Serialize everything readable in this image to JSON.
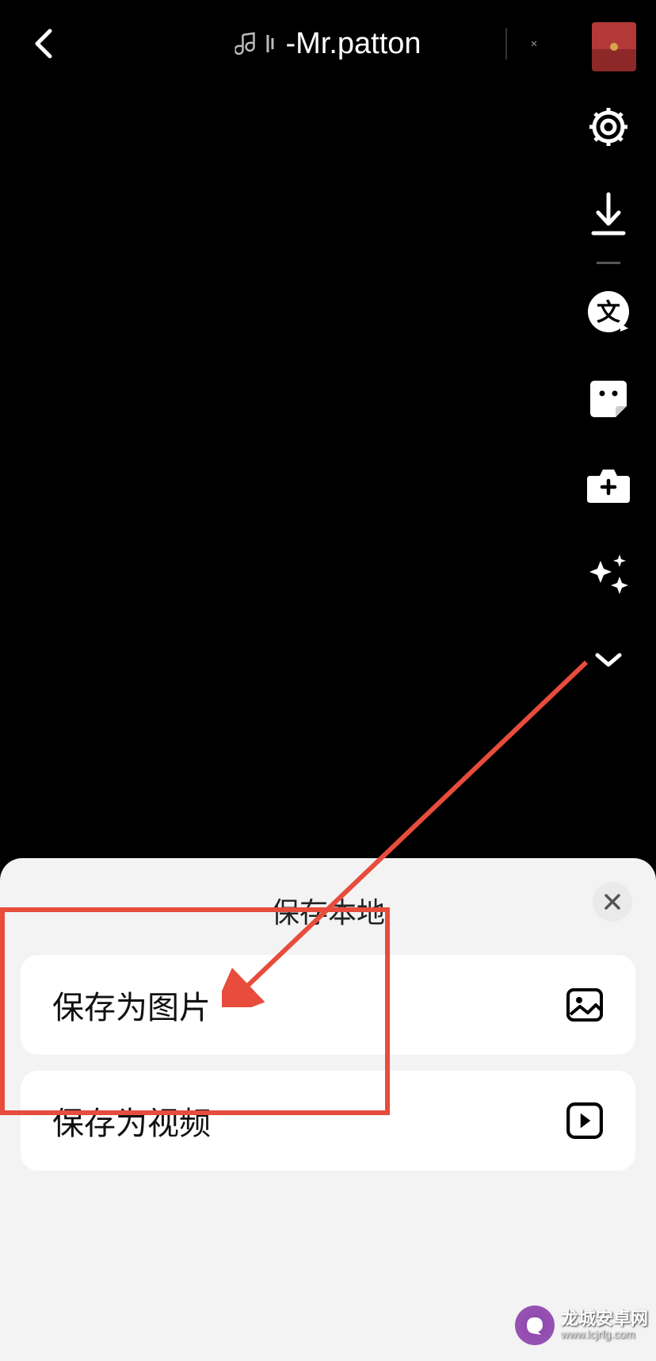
{
  "header": {
    "title": "-Mr.patton"
  },
  "sidebar": {
    "items": [
      "settings",
      "download",
      "text",
      "sticker",
      "effects",
      "sparkle",
      "expand"
    ]
  },
  "sheet": {
    "title": "保存本地",
    "options": [
      {
        "label": "保存为图片",
        "icon": "image"
      },
      {
        "label": "保存为视频",
        "icon": "video"
      }
    ]
  },
  "watermark": {
    "name": "龙城安卓网",
    "url": "www.lcjrfg.com"
  }
}
